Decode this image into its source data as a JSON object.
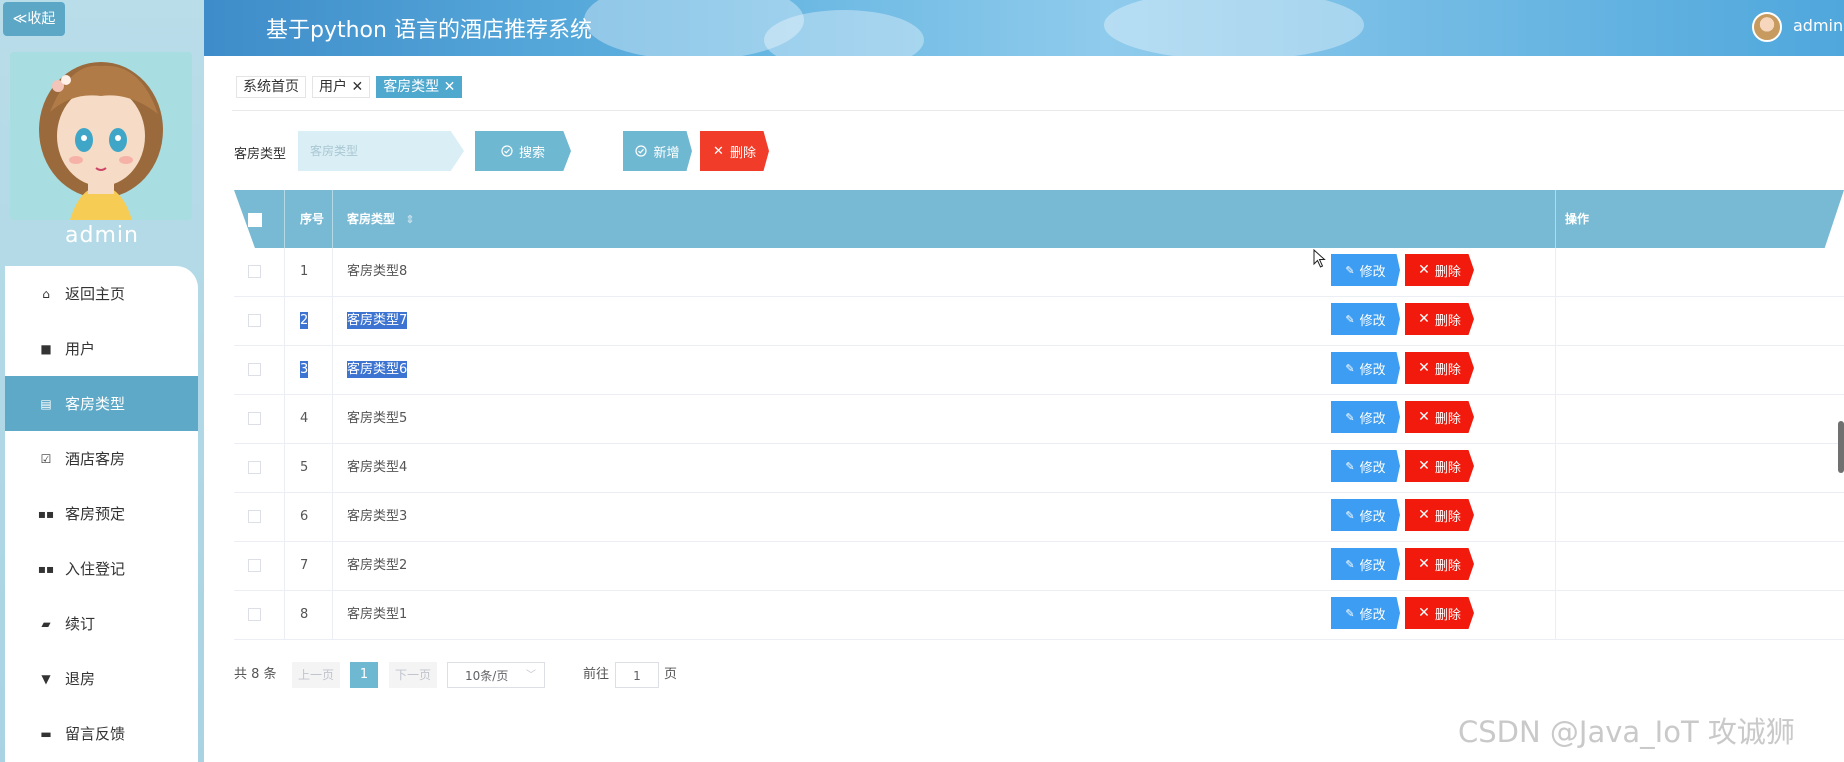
{
  "sidebar": {
    "collapse_label": "≪收起",
    "username": "admin",
    "menu": [
      {
        "label": "返回主页",
        "icon": "home-icon",
        "glyph": "⌂",
        "active": false
      },
      {
        "label": "用户",
        "icon": "monitor-icon",
        "glyph": "■",
        "active": false
      },
      {
        "label": "客房类型",
        "icon": "document-icon",
        "glyph": "▤",
        "active": true
      },
      {
        "label": "酒店客房",
        "icon": "clipboard-check-icon",
        "glyph": "☑",
        "active": false
      },
      {
        "label": "客房预定",
        "icon": "grid-icon",
        "glyph": "▪▪",
        "active": false
      },
      {
        "label": "入住登记",
        "icon": "grid-icon",
        "glyph": "▪▪",
        "active": false
      },
      {
        "label": "续订",
        "icon": "wallet-icon",
        "glyph": "▰",
        "active": false
      },
      {
        "label": "退房",
        "icon": "stamp-icon",
        "glyph": "▼",
        "active": false
      },
      {
        "label": "留言反馈",
        "icon": "printer-icon",
        "glyph": "▬",
        "active": false
      }
    ]
  },
  "header": {
    "title": "基于python 语言的酒店推荐系统",
    "user": "admin"
  },
  "tabs": [
    {
      "label": "系统首页",
      "closable": false,
      "active": false
    },
    {
      "label": "用户",
      "closable": true,
      "active": false
    },
    {
      "label": "客房类型",
      "closable": true,
      "active": true
    }
  ],
  "tab_close_glyph": "✕",
  "search": {
    "label": "客房类型",
    "placeholder": "客房类型",
    "search_button": "搜索",
    "add_button": "新增",
    "delete_button": "删除"
  },
  "table": {
    "headers": {
      "index": "序号",
      "type": "客房类型",
      "sort_glyph": "⇕",
      "action": "操作"
    },
    "edit_label": "修改",
    "delete_label": "删除",
    "rows": [
      {
        "index": "1",
        "type": "客房类型8",
        "highlighted": false
      },
      {
        "index": "2",
        "type": "客房类型7",
        "highlighted": true
      },
      {
        "index": "3",
        "type": "客房类型6",
        "highlighted": true
      },
      {
        "index": "4",
        "type": "客房类型5",
        "highlighted": false
      },
      {
        "index": "5",
        "type": "客房类型4",
        "highlighted": false
      },
      {
        "index": "6",
        "type": "客房类型3",
        "highlighted": false
      },
      {
        "index": "7",
        "type": "客房类型2",
        "highlighted": false
      },
      {
        "index": "8",
        "type": "客房类型1",
        "highlighted": false
      }
    ]
  },
  "pagination": {
    "total": "共 8 条",
    "prev": "上一页",
    "current": "1",
    "next": "下一页",
    "page_size": "10条/页",
    "goto_label": "前往",
    "goto_value": "1",
    "page_suffix": "页"
  },
  "watermark": "CSDN @Java_IoT 攻诚狮",
  "colors": {
    "accent": "#6fb8d2",
    "active_menu": "#5ea9c8",
    "edit_button": "#3c9df2",
    "delete_button": "#f21a0c",
    "selection": "#3d74d1"
  }
}
